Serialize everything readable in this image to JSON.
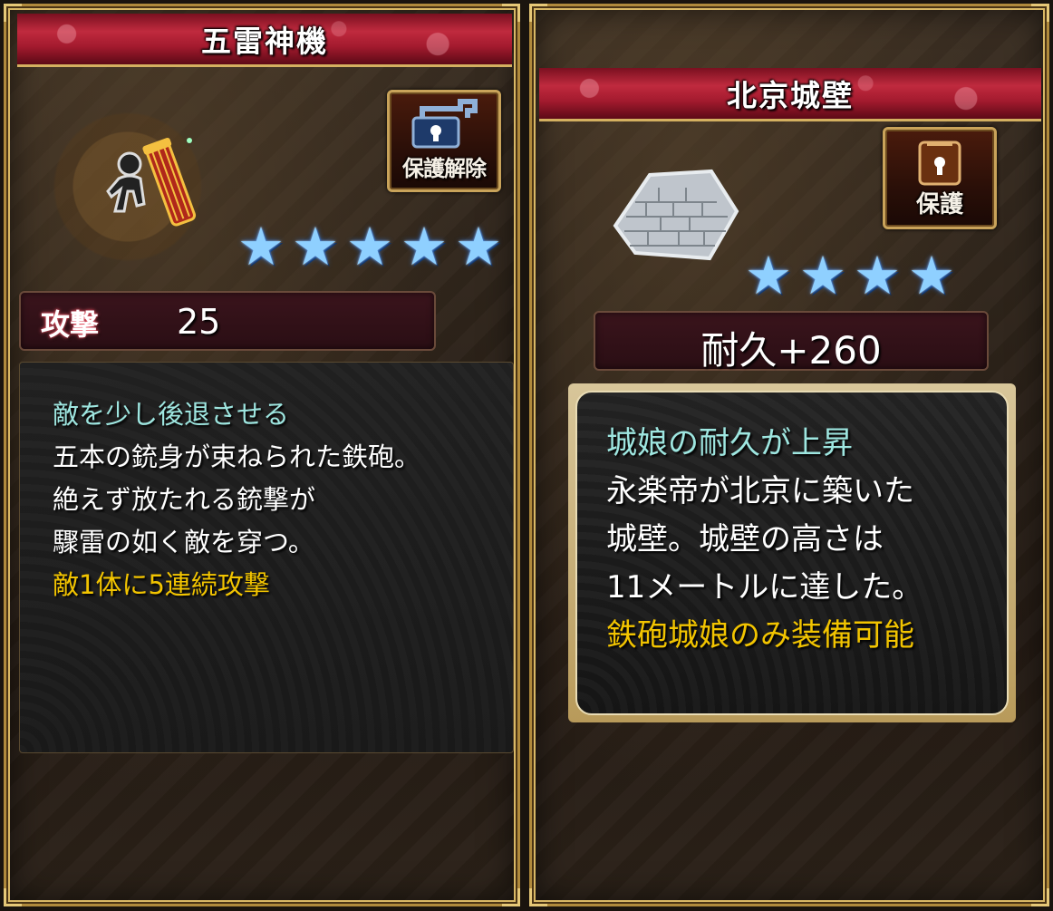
{
  "left_card": {
    "title": "五雷神機",
    "protect_button": {
      "label": "保護解除",
      "icon": "unlock-icon"
    },
    "rarity_stars": 5,
    "stat": {
      "label": "攻撃",
      "value": "25"
    },
    "description": [
      {
        "text": "敵を少し後退させる",
        "style": "teal"
      },
      {
        "text": "五本の銃身が束ねられた鉄砲。",
        "style": "white"
      },
      {
        "text": "絶えず放たれる銃撃が",
        "style": "white"
      },
      {
        "text": "驟雷の如く敵を穿つ。",
        "style": "white"
      },
      {
        "text": "敵1体に5連続攻撃",
        "style": "gold"
      }
    ],
    "item_icon": "gatling-gun-icon"
  },
  "right_card": {
    "title": "北京城壁",
    "protect_button": {
      "label": "保護",
      "icon": "lock-icon"
    },
    "rarity_stars": 4,
    "stat": {
      "text": "耐久+260"
    },
    "description": [
      {
        "text": "城娘の耐久が上昇",
        "style": "teal"
      },
      {
        "text": "永楽帝が北京に築いた",
        "style": "white"
      },
      {
        "text": "城壁。城壁の高さは",
        "style": "white"
      },
      {
        "text": "11メートルに達した。",
        "style": "white"
      },
      {
        "text": "鉄砲城娘のみ装備可能",
        "style": "gold"
      }
    ],
    "item_icon": "stone-wall-icon"
  },
  "colors": {
    "title_red": "#c02a3e",
    "frame_gold": "#d9b865",
    "star_blue": "#8fd0ff",
    "teal_text": "#9ee6e0",
    "gold_text": "#f2c400"
  }
}
